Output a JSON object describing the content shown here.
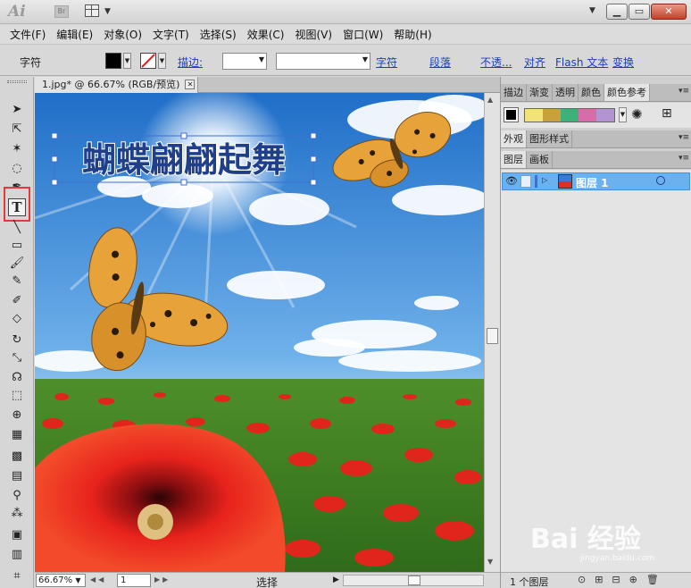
{
  "app": {
    "logo": "Ai",
    "bridge_label": "Br",
    "window_buttons": [
      "▁",
      "▭",
      "✕"
    ]
  },
  "menu": [
    "文件(F)",
    "编辑(E)",
    "对象(O)",
    "文字(T)",
    "选择(S)",
    "效果(C)",
    "视图(V)",
    "窗口(W)",
    "帮助(H)"
  ],
  "control_bar": {
    "label": "字符",
    "stroke_label": "描边:",
    "char_link": "字符",
    "para_link": "段落",
    "opacity_link": "不透...",
    "align_link": "对齐",
    "flash_link": "Flash 文本",
    "transform_link": "变换",
    "fill_color": "#000000"
  },
  "document": {
    "tab_title": "1.jpg* @ 66.67% (RGB/预览)",
    "headline": "蝴蝶翩翩起舞",
    "zoom": "66.67%",
    "page": "1",
    "status_tool": "选择"
  },
  "panels": {
    "top_tabs": [
      "描边",
      "渐变",
      "透明",
      "颜色",
      "颜色参考"
    ],
    "top_active": "颜色参考",
    "swatch_colors": [
      "#f2e27a",
      "#c8a13c",
      "#3bb27a",
      "#d86ba8",
      "#b493d2"
    ],
    "mid_tabs": [
      "外观",
      "图形样式"
    ],
    "layer_tabs": [
      "图层",
      "画板"
    ],
    "layer_name": "图层 1",
    "layer_count": "1 个图层"
  },
  "watermark": {
    "brand": "Bai 经验",
    "url": "jingyan.baidu.com"
  }
}
